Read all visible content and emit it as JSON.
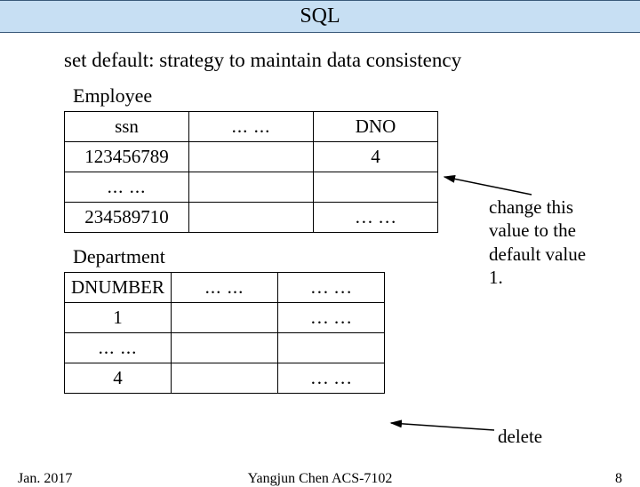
{
  "header": {
    "title": "SQL"
  },
  "subtitle": "set default: strategy to maintain data consistency",
  "employee": {
    "label": "Employee",
    "headers": {
      "c1": "ssn",
      "c2": "... ...",
      "c3": "DNO"
    },
    "rows": [
      {
        "c1": "123456789",
        "c2": "",
        "c3": "4"
      },
      {
        "c1": "... ...",
        "c2": "",
        "c3": ""
      },
      {
        "c1": "234589710",
        "c2": "",
        "c3": "… …"
      }
    ]
  },
  "department": {
    "label": "Department",
    "headers": {
      "c1": "DNUMBER",
      "c2": "... ...",
      "c3": "… …"
    },
    "rows": [
      {
        "c1": "1",
        "c2": "",
        "c3": "… …"
      },
      {
        "c1": "... ...",
        "c2": "",
        "c3": ""
      },
      {
        "c1": "4",
        "c2": "",
        "c3": "… …"
      }
    ]
  },
  "annotations": {
    "change": "change this\nvalue to the\ndefault value\n1.",
    "delete": "delete"
  },
  "footer": {
    "left": "Jan. 2017",
    "center": "Yangjun Chen       ACS-7102",
    "right": "8"
  }
}
